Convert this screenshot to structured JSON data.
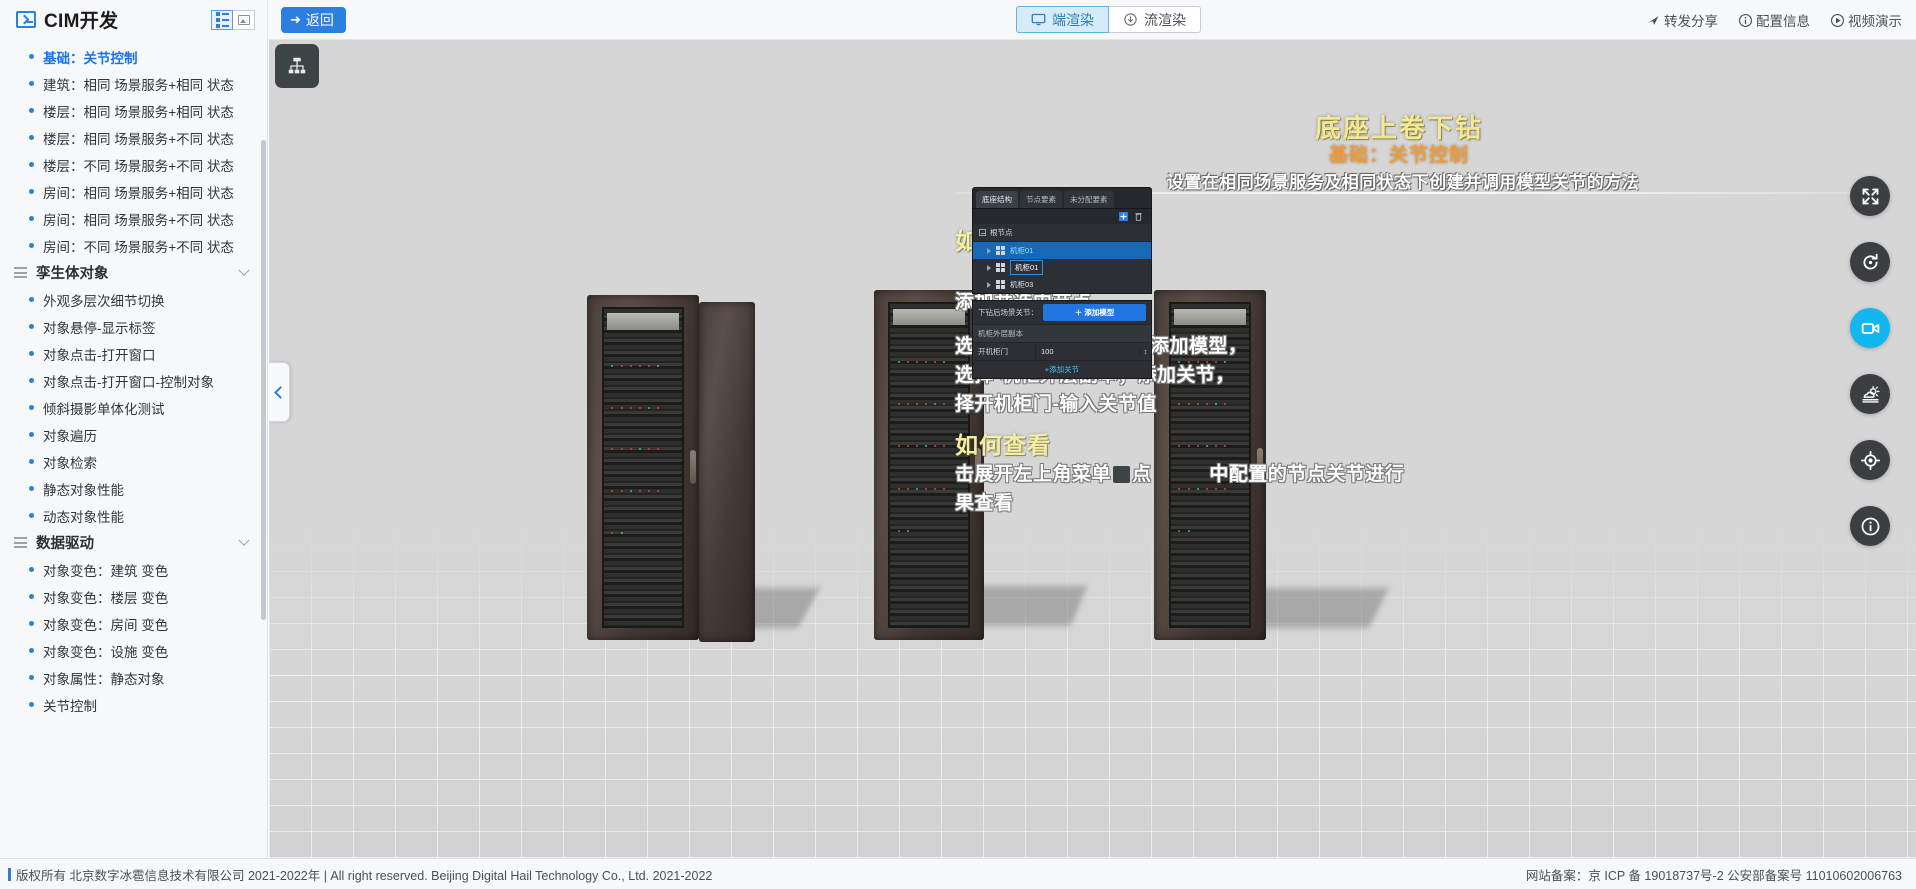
{
  "header": {
    "brand_title": "CIM开发",
    "view_toggle_list": "list-view",
    "view_toggle_card": "card-view",
    "back_label": "返回",
    "render_modes": [
      {
        "label": "端渲染",
        "icon": "monitor-icon",
        "active": true
      },
      {
        "label": "流渲染",
        "icon": "cloud-download-icon",
        "active": false
      }
    ],
    "actions": [
      {
        "label": "转发分享",
        "icon": "share-icon"
      },
      {
        "label": "配置信息",
        "icon": "info-circle-icon"
      },
      {
        "label": "视频演示",
        "icon": "play-circle-icon"
      }
    ]
  },
  "sidebar": {
    "items": [
      {
        "type": "item",
        "label": "基础：关节控制",
        "active": true
      },
      {
        "type": "item",
        "label": "建筑：相同 场景服务+相同 状态"
      },
      {
        "type": "item",
        "label": "楼层：相同 场景服务+相同 状态"
      },
      {
        "type": "item",
        "label": "楼层：相同 场景服务+不同 状态"
      },
      {
        "type": "item",
        "label": "楼层：不同 场景服务+不同 状态"
      },
      {
        "type": "item",
        "label": "房间：相同 场景服务+相同 状态"
      },
      {
        "type": "item",
        "label": "房间：相同 场景服务+不同 状态"
      },
      {
        "type": "item",
        "label": "房间：不同 场景服务+不同 状态"
      },
      {
        "type": "group",
        "label": "孪生体对象"
      },
      {
        "type": "item",
        "label": "外观多层次细节切换"
      },
      {
        "type": "item",
        "label": "对象悬停-显示标签"
      },
      {
        "type": "item",
        "label": "对象点击-打开窗口"
      },
      {
        "type": "item",
        "label": "对象点击-打开窗口-控制对象"
      },
      {
        "type": "item",
        "label": "倾斜摄影单体化测试"
      },
      {
        "type": "item",
        "label": "对象遍历"
      },
      {
        "type": "item",
        "label": "对象检索"
      },
      {
        "type": "item",
        "label": "静态对象性能"
      },
      {
        "type": "item",
        "label": "动态对象性能"
      },
      {
        "type": "group",
        "label": "数据驱动"
      },
      {
        "type": "item",
        "label": "对象变色：建筑 变色"
      },
      {
        "type": "item",
        "label": "对象变色：楼层 变色"
      },
      {
        "type": "item",
        "label": "对象变色：房间 变色"
      },
      {
        "type": "item",
        "label": "对象变色：设施 变色"
      },
      {
        "type": "item",
        "label": "对象属性：静态对象"
      },
      {
        "type": "item",
        "label": "关节控制"
      }
    ]
  },
  "viewport": {
    "menu_button_icon": "hierarchy-icon",
    "collapse_icon": "chevron-left-icon",
    "rail": [
      {
        "icon": "fullscreen-icon",
        "active": false
      },
      {
        "icon": "rotate-icon",
        "active": false
      },
      {
        "icon": "video-icon",
        "active": true
      },
      {
        "icon": "weather-icon",
        "active": false
      },
      {
        "icon": "locate-icon",
        "active": false
      },
      {
        "icon": "info-icon",
        "active": false
      }
    ],
    "overlay": {
      "title": "底座上卷下钻",
      "subtitle": "基础：关节控制",
      "description": "设置在相同场景服务及相同状态下创建并调用模型关节的方法",
      "section_use": "如何使用",
      "use_step_title": "添加并选中节点",
      "use_steps": "选择下钻后场景关节，添加模型，\n选择-机柜外层副本；添加关节，\n择开机柜门-输入关节值",
      "section_view": "如何查看",
      "view_text_a": "击展开左上角菜单",
      "view_text_b": "点",
      "view_text_c": "中配置的节点关节进行",
      "view_text_d": "果查看",
      "colors": {
        "title": "#f5e98f",
        "subtitle": "#f19a33",
        "heading": "#f6efa2",
        "body": "#ffffff"
      }
    },
    "scene_panel": {
      "tabs": [
        {
          "label": "底座结构",
          "active": true
        },
        {
          "label": "节点要素",
          "active": false
        },
        {
          "label": "未分配要素",
          "active": false
        }
      ],
      "tools": [
        {
          "icon": "add-node-icon"
        },
        {
          "icon": "delete-icon"
        }
      ],
      "tree_root": "根节点",
      "tree_rows": [
        {
          "label": "机柜01",
          "selected": true,
          "editing": false
        },
        {
          "label": "机柜01",
          "selected": false,
          "editing": true
        },
        {
          "label": "机柜03",
          "selected": false,
          "editing": false
        }
      ],
      "prop_label": "下钻后场景关节：",
      "add_model_btn": "＋ 添加模型",
      "sub_label": "机柜外层副本",
      "field_key": "开机柜门",
      "field_value": "100",
      "add_joint_btn": "+添加关节"
    }
  },
  "footer": {
    "left": "版权所有 北京数字冰雹信息技术有限公司 2021-2022年 | All right reserved. Beijing Digital Hail Technology Co., Ltd. 2021-2022",
    "right": "网站备案：京 ICP 备 19018737号-2 公安部备案号 11010602006763"
  }
}
